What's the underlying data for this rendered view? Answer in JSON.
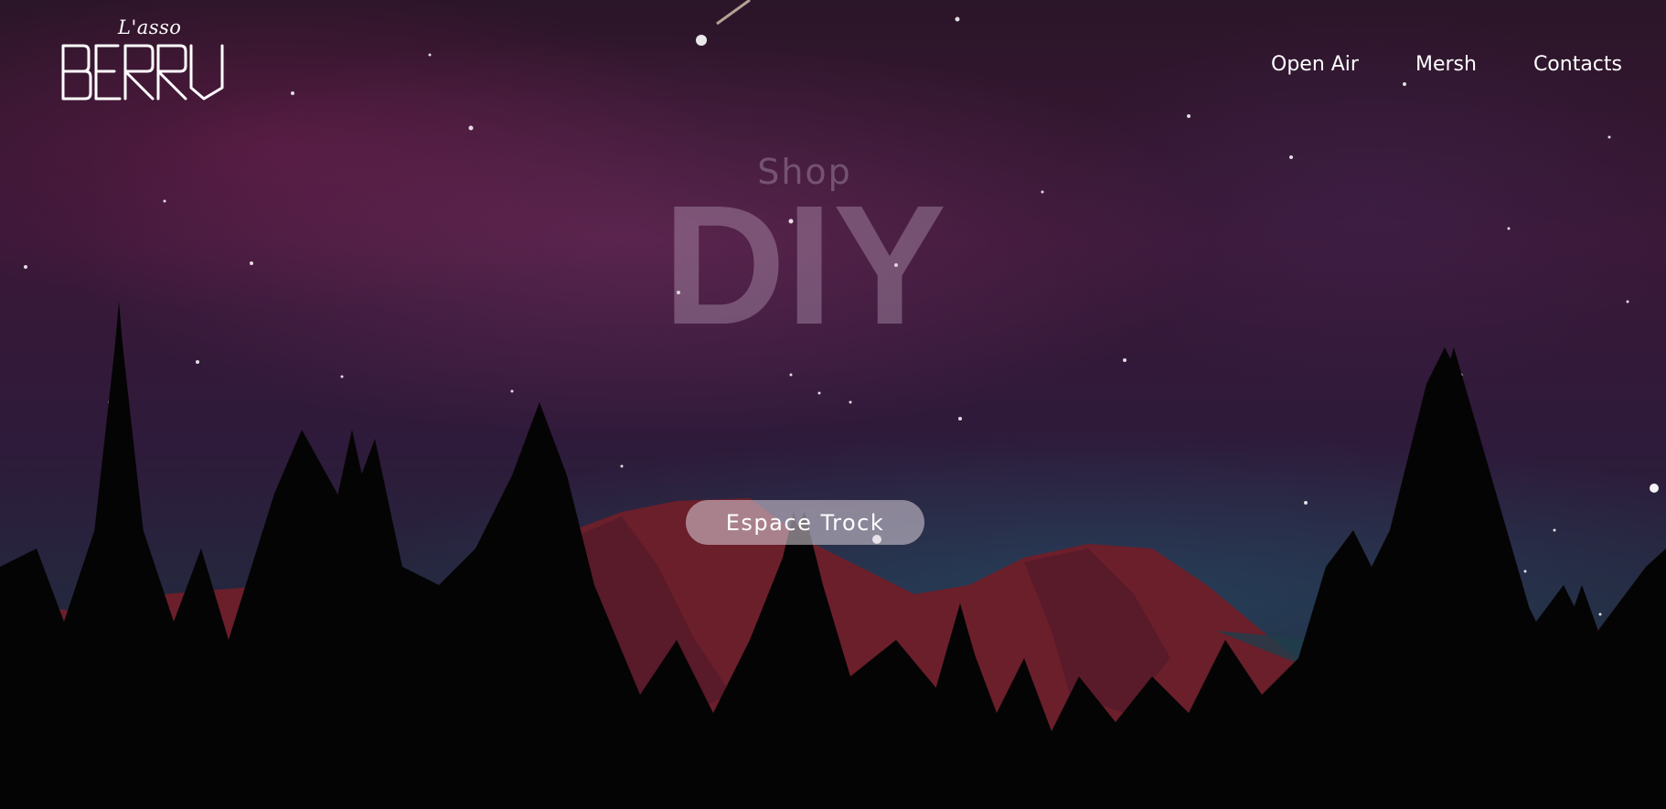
{
  "logo": {
    "small_text": "L'asso",
    "main_text": "BERRU"
  },
  "nav": {
    "items": [
      "Open Air",
      "Mersh",
      "Contacts"
    ]
  },
  "hero": {
    "subtitle": "Shop",
    "title": "DIY",
    "cta_label": "Espace Trock"
  },
  "colors": {
    "sky_top": "#2b1528",
    "mountain": "#6b1f2a",
    "trees": "#050405",
    "text": "#ffffff"
  }
}
